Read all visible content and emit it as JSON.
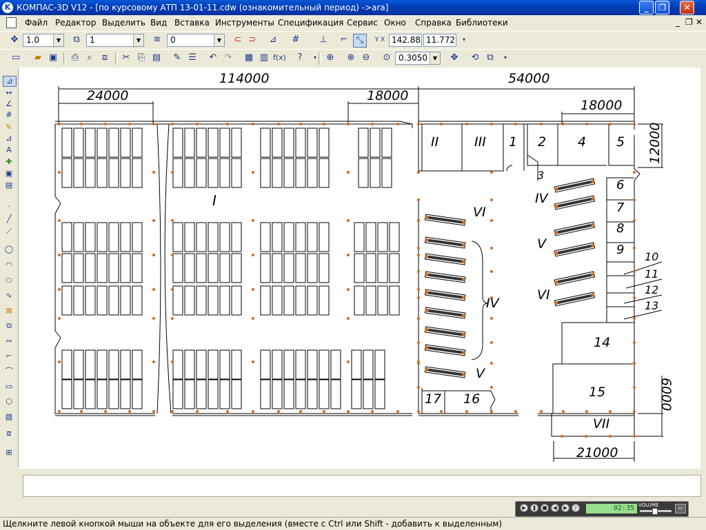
{
  "window": {
    "app_icon_letter": "K",
    "title": "КОМПАС-3D V12 - [по курсовому АТП  13-01-11.cdw (ознакомительный период) ->ara]",
    "minimize_label": "_",
    "maximize_label": "❐",
    "close_label": "✕"
  },
  "menu": {
    "items": [
      "Файл",
      "Редактор",
      "Выделить",
      "Вид",
      "Вставка",
      "Инструменты",
      "Спецификация",
      "Сервис",
      "Окно",
      "Справка",
      "Библиотеки"
    ],
    "doc_minimize": "_",
    "doc_restore": "❐",
    "doc_close": "✕"
  },
  "toolbar1": {
    "step_value": "1.0",
    "layer_value": "1",
    "style_value": "0",
    "x_coord": "142.883",
    "y_coord": "11.772"
  },
  "toolbar2": {
    "zoom_value": "0.3050"
  },
  "drawing": {
    "dim_total_left": "114000",
    "dim_total_right": "54000",
    "dim_24000": "24000",
    "dim_18000_left": "18000",
    "dim_18000_right": "18000",
    "dim_12000": "12000",
    "dim_6000": "6000",
    "dim_21000": "21000",
    "zone_I": "I",
    "zone_II": "II",
    "zone_III": "III",
    "zone_IV_top": "IV",
    "zone_IV_mid": "IV",
    "zone_V_mid": "V",
    "zone_V_bottom": "V",
    "zone_VI_left": "VI",
    "zone_VI_right": "VI",
    "zone_VII": "VII",
    "rooms": [
      "1",
      "2",
      "3",
      "4",
      "5",
      "6",
      "7",
      "8",
      "9",
      "10",
      "11",
      "12",
      "13",
      "14",
      "15",
      "16",
      "17"
    ]
  },
  "player": {
    "time": "02:35",
    "volume_label": "VOLUME",
    "volume_level": 0.45
  },
  "status": {
    "hint": "Щелкните левой кнопкой мыши на объекте для его выделения (вместе с Ctrl или Shift - добавить к выделенным)"
  },
  "colors": {
    "title_bar": "#0a58d8",
    "canvas": "#ffffff",
    "node_marker": "#d2691e"
  }
}
